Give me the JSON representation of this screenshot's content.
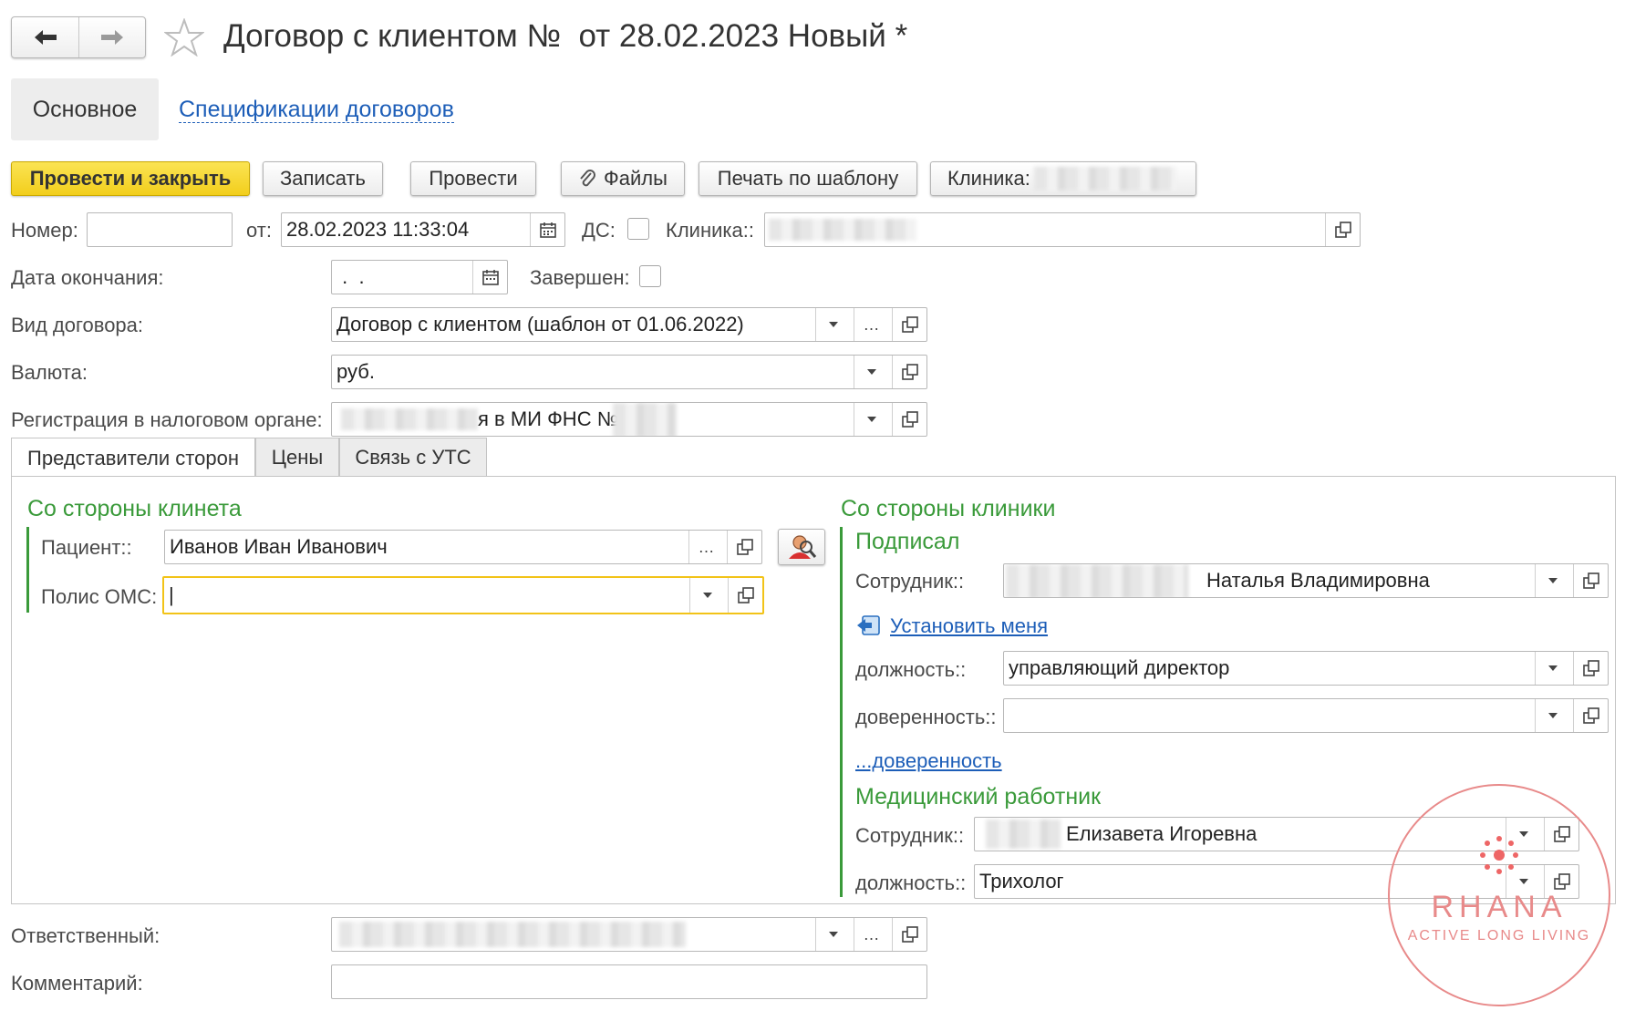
{
  "header": {
    "title": "Договор с клиентом №  от 28.02.2023 Новый *",
    "back_icon": "arrow-left-icon",
    "forward_icon": "arrow-right-icon",
    "favorite_icon": "star-icon"
  },
  "sections": {
    "main": "Основное",
    "specs": "Спецификации договоров"
  },
  "toolbar": {
    "post_close": "Провести и закрыть",
    "save": "Записать",
    "post": "Провести",
    "files": "Файлы",
    "print": "Печать по шаблону",
    "clinic": "Клиника:"
  },
  "form": {
    "number_label": "Номер:",
    "number_value": "",
    "from_label": "от:",
    "date_value": "28.02.2023 11:33:04",
    "ds_label": "ДС:",
    "clinic_label": "Клиника::",
    "end_date_label": "Дата окончания:",
    "end_date_value": " .  .",
    "completed_label": "Завершен:",
    "contract_type_label": "Вид договора:",
    "contract_type_value": "Договор с клиентом (шаблон от 01.06.2022)",
    "currency_label": "Валюта:",
    "currency_value": "руб.",
    "tax_label": "Регистрация в налоговом органе:",
    "tax_value": "я в МИ ФНС №4",
    "responsible_label": "Ответственный:",
    "comment_label": "Комментарий:",
    "comment_value": ""
  },
  "tabs": [
    "Представители сторон",
    "Цены",
    "Связь с УТС"
  ],
  "client_side": {
    "title": "Со стороны клинета",
    "patient_label": "Пациент::",
    "patient_value": "Иванов Иван Иванович",
    "oms_label": "Полис ОМС:",
    "oms_value": "|"
  },
  "clinic_side": {
    "title": "Со стороны клиники",
    "signed_title": "Подписал",
    "employee_label": "Сотрудник::",
    "employee_value": "Наталья Владимировна",
    "set_me": "Установить меня",
    "position_label": "должность::",
    "position_value": "управляющий директор",
    "attorney_label": "доверенность::",
    "attorney_value": "",
    "attorney_link": "...доверенность",
    "medic_title": "Медицинский работник",
    "medic_employee_label": "Сотрудник::",
    "medic_employee_value": "Елизавета Игоревна",
    "medic_position_label": "должность::",
    "medic_position_value": "Трихолог"
  },
  "watermark": {
    "brand": "RHANA",
    "tagline": "ACTIVE LONG LIVING",
    "color": "#e88a8a"
  },
  "colors": {
    "accent_yellow": "#f2ce1c",
    "section_green": "#3a9a3a",
    "link_blue": "#1d5eb8"
  }
}
